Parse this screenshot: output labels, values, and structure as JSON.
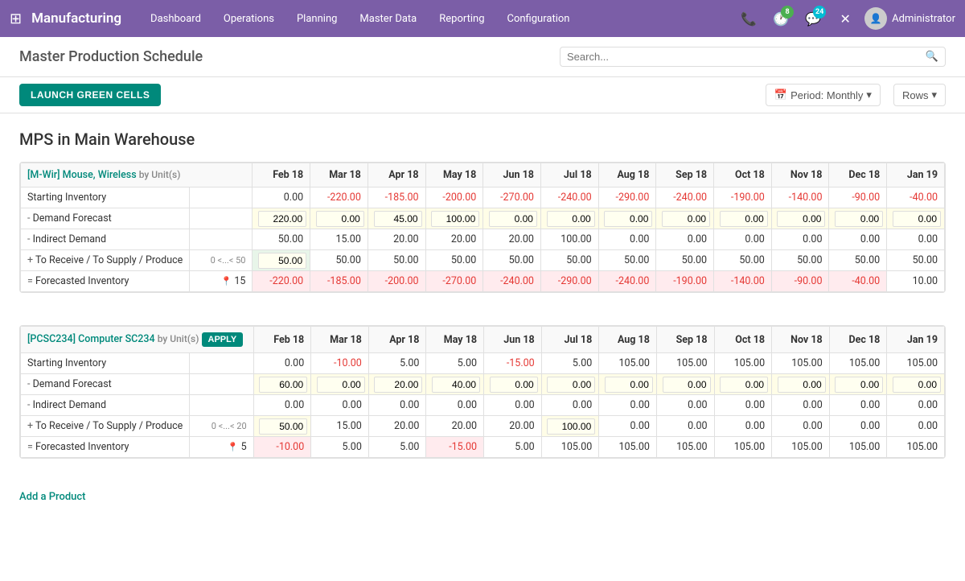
{
  "app": {
    "brand": "Manufacturing",
    "nav_items": [
      "Dashboard",
      "Operations",
      "Planning",
      "Master Data",
      "Reporting",
      "Configuration"
    ],
    "badge_messages": "8",
    "badge_alerts": "24",
    "user": "Administrator"
  },
  "page": {
    "title": "Master Production Schedule",
    "search_placeholder": "Search...",
    "launch_btn": "LAUNCH GREEN CELLS",
    "period_label": "Period: Monthly",
    "rows_label": "Rows",
    "section_title": "MPS in Main Warehouse"
  },
  "products": [
    {
      "id": "M-Wir",
      "name": "Mouse, Wireless",
      "unit": "Unit(s)",
      "apply": false,
      "range": "0 <...< 50",
      "pin_value": "15",
      "months": [
        "Feb 18",
        "Mar 18",
        "Apr 18",
        "May 18",
        "Jun 18",
        "Jul 18",
        "Aug 18",
        "Sep 18",
        "Oct 18",
        "Nov 18",
        "Dec 18",
        "Jan 19"
      ],
      "rows": {
        "starting": [
          "0.00",
          "-220.00",
          "-185.00",
          "-200.00",
          "-270.00",
          "-240.00",
          "-290.00",
          "-240.00",
          "-190.00",
          "-140.00",
          "-90.00",
          "-40.00"
        ],
        "demand_forecast": [
          "220.00",
          "0.00",
          "45.00",
          "100.00",
          "0.00",
          "0.00",
          "0.00",
          "0.00",
          "0.00",
          "0.00",
          "0.00",
          "0.00"
        ],
        "indirect_demand": [
          "50.00",
          "15.00",
          "20.00",
          "20.00",
          "20.00",
          "100.00",
          "0.00",
          "0.00",
          "0.00",
          "0.00",
          "0.00",
          "0.00"
        ],
        "receive_supply": [
          "50.00",
          "50.00",
          "50.00",
          "50.00",
          "50.00",
          "50.00",
          "50.00",
          "50.00",
          "50.00",
          "50.00",
          "50.00",
          "50.00"
        ],
        "forecasted": [
          "-220.00",
          "-185.00",
          "-200.00",
          "-270.00",
          "-240.00",
          "-290.00",
          "-240.00",
          "-190.00",
          "-140.00",
          "-90.00",
          "-40.00",
          "10.00"
        ]
      },
      "receive_first_editable": true,
      "demand_editable": [
        true,
        true,
        true,
        true,
        true,
        true,
        true,
        true,
        true,
        true,
        true,
        true
      ]
    },
    {
      "id": "PCSC234",
      "name": "Computer SC234",
      "unit": "Unit(s)",
      "apply": true,
      "range": "0 <...< 20",
      "pin_value": "5",
      "months": [
        "Feb 18",
        "Mar 18",
        "Apr 18",
        "May 18",
        "Jun 18",
        "Jul 18",
        "Aug 18",
        "Sep 18",
        "Oct 18",
        "Nov 18",
        "Dec 18",
        "Jan 19"
      ],
      "rows": {
        "starting": [
          "0.00",
          "-10.00",
          "5.00",
          "5.00",
          "-15.00",
          "5.00",
          "105.00",
          "105.00",
          "105.00",
          "105.00",
          "105.00",
          "105.00"
        ],
        "demand_forecast": [
          "60.00",
          "0.00",
          "20.00",
          "40.00",
          "0.00",
          "0.00",
          "0.00",
          "0.00",
          "0.00",
          "0.00",
          "0.00",
          "0.00"
        ],
        "indirect_demand": [
          "0.00",
          "0.00",
          "0.00",
          "0.00",
          "0.00",
          "0.00",
          "0.00",
          "0.00",
          "0.00",
          "0.00",
          "0.00",
          "0.00"
        ],
        "receive_supply": [
          "50.00",
          "15.00",
          "20.00",
          "20.00",
          "20.00",
          "100.00",
          "0.00",
          "0.00",
          "0.00",
          "0.00",
          "0.00",
          "0.00"
        ],
        "forecasted": [
          "-10.00",
          "5.00",
          "5.00",
          "-15.00",
          "5.00",
          "105.00",
          "105.00",
          "105.00",
          "105.00",
          "105.00",
          "105.00",
          "105.00"
        ]
      },
      "receive_first_editable": true,
      "demand_editable": [
        true,
        true,
        true,
        true,
        true,
        true,
        true,
        true,
        true,
        true,
        true,
        true
      ]
    }
  ],
  "footer": {
    "add_product": "Add a Product"
  }
}
